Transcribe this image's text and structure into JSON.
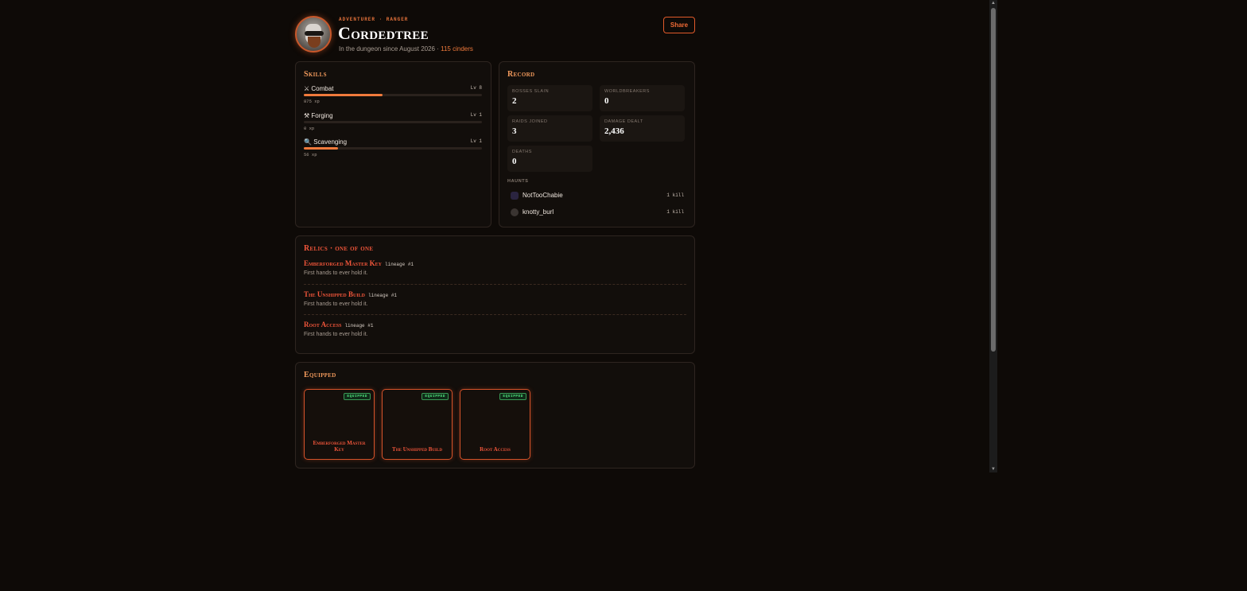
{
  "header": {
    "eyebrow": "ADVENTURER · RANGER",
    "name": "Cordedtree",
    "since_text": "In the dungeon since August 2026 · ",
    "cinders": "115 cinders",
    "share_label": "Share"
  },
  "skills": {
    "title": "Skills",
    "items": [
      {
        "icon": "⚔",
        "name": "Combat",
        "level": "Lv 8",
        "xp": "875 xp",
        "progress": 0.44
      },
      {
        "icon": "⚒",
        "name": "Forging",
        "level": "Lv 1",
        "xp": "0 xp",
        "progress": 0
      },
      {
        "icon": "🔍",
        "name": "Scavenging",
        "level": "Lv 1",
        "xp": "56 xp",
        "progress": 0.19
      }
    ]
  },
  "record": {
    "title": "Record",
    "stats": [
      {
        "label": "BOSSES SLAIN",
        "value": "2"
      },
      {
        "label": "WORLDBREAKERS",
        "value": "0"
      },
      {
        "label": "RAIDS JOINED",
        "value": "3"
      },
      {
        "label": "DAMAGE DEALT",
        "value": "2,436"
      },
      {
        "label": "DEATHS",
        "value": "0"
      }
    ],
    "haunts_label": "HAUNTS",
    "haunts": [
      {
        "name": "NotTooChabie",
        "kills": "1 kill"
      },
      {
        "name": "knotty_burl",
        "kills": "1 kill"
      }
    ]
  },
  "relics": {
    "title": "Relics · one of one",
    "items": [
      {
        "name": "Emberforged Master Key",
        "lineage": "lineage #1",
        "desc": "First hands to ever hold it."
      },
      {
        "name": "The Unshipped Build",
        "lineage": "lineage #1",
        "desc": "First hands to ever hold it."
      },
      {
        "name": "Root Access",
        "lineage": "lineage #1",
        "desc": "First hands to ever hold it."
      }
    ]
  },
  "equipped": {
    "title": "Equipped",
    "badge": "EQUIPPED",
    "items": [
      {
        "name": "Emberforged Master Key"
      },
      {
        "name": "The Unshipped Build"
      },
      {
        "name": "Root Access"
      }
    ]
  },
  "colors": {
    "accent": "#f07a3c",
    "relic": "#f0553a",
    "equipped_badge": "#4fe07a",
    "background": "#0e0a07"
  }
}
